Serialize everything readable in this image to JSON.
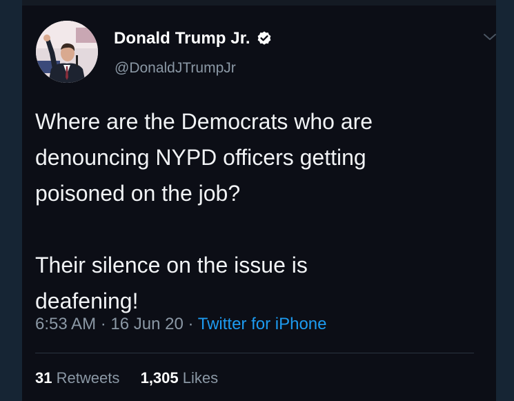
{
  "tweet": {
    "author": {
      "display_name": "Donald Trump Jr.",
      "handle": "@DonaldJTrumpJr",
      "verified": true,
      "avatar_icon": "profile-photo-icon"
    },
    "text": "Where are the Democrats who are\ndenouncing NYPD officers getting\npoisoned on the job?\n\nTheir silence on the issue is\ndeafening!",
    "time": "6:53 AM",
    "date": "16 Jun 20",
    "source": "Twitter for iPhone",
    "separator": "·",
    "retweets_count": "31",
    "retweets_label": "Retweets",
    "likes_count": "1,305",
    "likes_label": "Likes"
  },
  "colors": {
    "background": "#0c0e16",
    "outer": "#162534",
    "text": "#f1f3f5",
    "muted": "#8b98a5",
    "accent": "#1d9bf0"
  },
  "icons": {
    "verified": "verified-badge-icon",
    "menu": "chevron-down-icon"
  }
}
